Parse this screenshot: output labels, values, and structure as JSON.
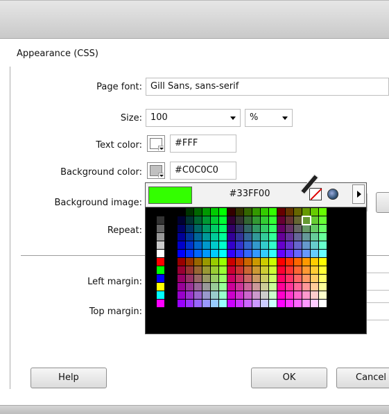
{
  "section": {
    "label": "Appearance (CSS)"
  },
  "fields": {
    "page_font": {
      "label": "Page font:",
      "value": "Gill Sans, sans-serif"
    },
    "size": {
      "label": "Size:",
      "value": "100",
      "unit": "%"
    },
    "text_color": {
      "label": "Text color:",
      "value": "#FFF",
      "swatch": "#FFFFFF"
    },
    "background_color": {
      "label": "Background color:",
      "value": "#C0C0C0",
      "swatch": "#C0C0C0"
    },
    "background_image": {
      "label": "Background image:"
    },
    "repeat": {
      "label": "Repeat:"
    },
    "left_margin": {
      "label": "Left margin:"
    },
    "top_margin": {
      "label": "Top margin:"
    }
  },
  "color_picker": {
    "current_hex": "#33FF00",
    "current_color": "#33FF00",
    "left_column_colors": [
      "#000000",
      "#333333",
      "#666666",
      "#999999",
      "#CCCCCC",
      "#FFFFFF",
      "#FF0000",
      "#00FF00",
      "#0000FF",
      "#FFFF00",
      "#00FFFF",
      "#FF00FF"
    ],
    "selected_cell": {
      "row": 1,
      "col": 15
    }
  },
  "buttons": {
    "help": "Help",
    "ok": "OK",
    "cancel": "Cancel"
  }
}
